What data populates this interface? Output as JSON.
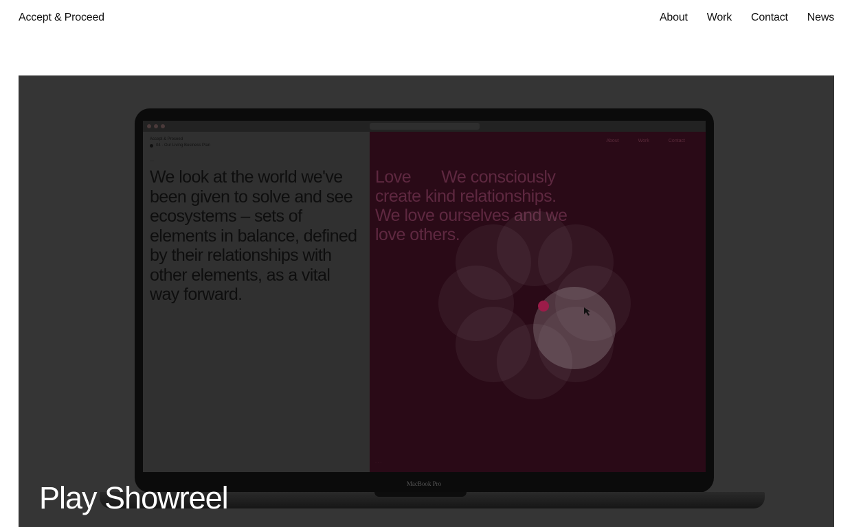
{
  "header": {
    "brand": "Accept & Proceed",
    "nav": [
      "About",
      "Work",
      "Contact",
      "News"
    ]
  },
  "hero": {
    "cta_label": "Play Showreel",
    "background_color": "#353535",
    "laptop": {
      "model_label": "MacBook Pro",
      "left_pane": {
        "brand": "Accept & Proceed",
        "subtitle": "04 · Our Living Business Plan",
        "text": "We look at the world we've been given to solve and see ecosystems – sets of elements in balance, defined by their relationships with other elements, as a vital way forward."
      },
      "right_pane": {
        "nav": [
          "About",
          "Work",
          "Contact"
        ],
        "heading_word": "Love",
        "text": "We consciously create kind relationships. We love ourselves and we love others.",
        "accent_color": "#9b1c49"
      }
    }
  }
}
